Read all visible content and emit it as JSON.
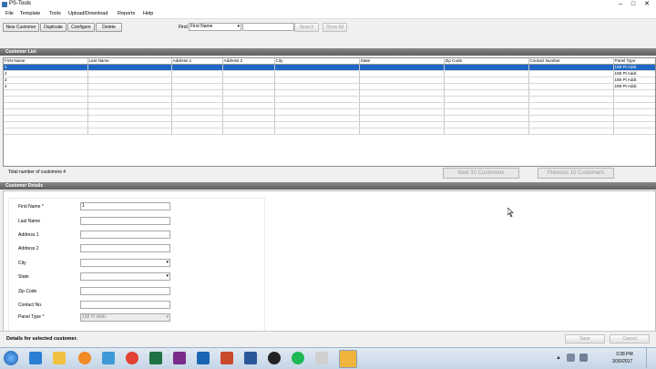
{
  "window": {
    "title": "PS-Tools",
    "min": "–",
    "max": "□",
    "close": "✕"
  },
  "menu": [
    "File",
    "Template",
    "Tools",
    "Upload/Download",
    "Reports",
    "Help"
  ],
  "toolbar": {
    "new_customer": "New Customer",
    "duplicate": "Duplicate",
    "configure": "Configure",
    "delete": "Delete",
    "find_label": "Find",
    "find_field_value": "First Name",
    "search_value": "",
    "search": "Search",
    "show_all": "Show All"
  },
  "customer_list": {
    "header": "Customer List",
    "columns": [
      "First Name",
      "Last Name",
      "Address 1",
      "Address 2",
      "City",
      "State",
      "Zip Code",
      "Contact Number",
      "Panel Type"
    ],
    "rows": [
      [
        "1",
        "",
        "",
        "",
        "",
        "",
        "",
        "",
        "198 Pt Addr."
      ],
      [
        "2",
        "",
        "",
        "",
        "",
        "",
        "",
        "",
        "198 Pt Addr."
      ],
      [
        "3",
        "",
        "",
        "",
        "",
        "",
        "",
        "",
        "198 Pt Addr."
      ],
      [
        "4",
        "",
        "",
        "",
        "",
        "",
        "",
        "",
        "198 Pt Addr."
      ]
    ],
    "total_label": "Total number of customers 4",
    "next": "Next 10 Customers",
    "previous": "Previous 10 Customers"
  },
  "details": {
    "header": "Customer Details",
    "fields": {
      "first_name": {
        "label": "First Name *",
        "value": "1"
      },
      "last_name": {
        "label": "Last Name",
        "value": ""
      },
      "address1": {
        "label": "Address 1",
        "value": ""
      },
      "address2": {
        "label": "Address 2",
        "value": ""
      },
      "city": {
        "label": "City",
        "value": ""
      },
      "state": {
        "label": "State",
        "value": ""
      },
      "zip": {
        "label": "Zip Code",
        "value": ""
      },
      "contact": {
        "label": "Contact No.",
        "value": ""
      },
      "panel_type": {
        "label": "Panel Type *",
        "value": "198 Pt Addr."
      }
    }
  },
  "status": {
    "text": "Details for selected customer.",
    "save": "Save",
    "cancel": "Cancel"
  },
  "taskbar": {
    "time": "3:38 PM",
    "date": "3/30/2017"
  },
  "colors": {
    "selection": "#1f67c4",
    "section_header": "#6e6e6e"
  }
}
